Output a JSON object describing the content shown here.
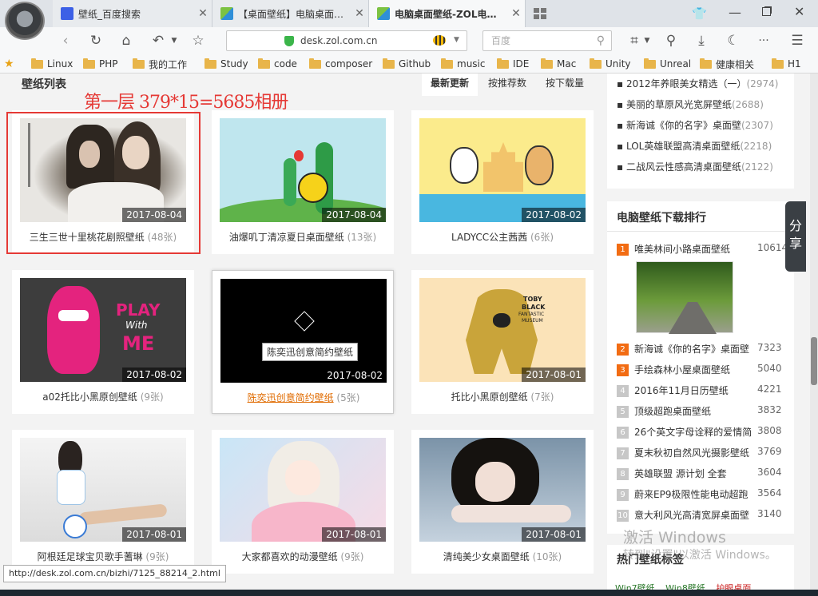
{
  "browser": {
    "tabs": [
      {
        "title": "壁纸_百度搜索",
        "icon": "baidu-paw-icon"
      },
      {
        "title": "【桌面壁纸】电脑桌面…",
        "icon": "zol-z-icon"
      },
      {
        "title": "电脑桌面壁纸-ZOL电…",
        "icon": "zol-z-icon"
      }
    ],
    "url": "desk.zol.com.cn",
    "search_placeholder": "百度",
    "status_url": "http://desk.zol.com.cn/bizhi/7125_88214_2.html"
  },
  "bookmarks": [
    "Linux",
    "PHP",
    "我的工作",
    "Study",
    "code",
    "composer",
    "Github",
    "music",
    "IDE",
    "Mac",
    "Unity",
    "Unreal",
    "健康相关",
    "H1"
  ],
  "section": {
    "title": "壁纸列表",
    "sort_tabs": [
      "最新更新",
      "按推荐数",
      "按下载量"
    ],
    "annotation": "第一层 379*15=5685相册"
  },
  "cards": [
    {
      "title": "三生三世十里桃花剧照壁纸",
      "count": "(48张)",
      "date": "2017-08-04"
    },
    {
      "title": "油爆叽丁清凉夏日桌面壁纸",
      "count": "(13张)",
      "date": "2017-08-04"
    },
    {
      "title": "LADYCC公主茜茜",
      "count": "(6张)",
      "date": "2017-08-02"
    },
    {
      "title": "a02托比小黑原创壁纸",
      "count": "(9张)",
      "date": "2017-08-02"
    },
    {
      "title": "陈奕迅创意简约壁纸",
      "count": "(5张)",
      "date": "2017-08-02",
      "tooltip": "陈奕迅创意简约壁纸"
    },
    {
      "title": "托比小黑原创壁纸",
      "count": "(7张)",
      "date": "2017-08-01"
    },
    {
      "title": "阿根廷足球宝贝歌手蓍琳",
      "count": "(9张)",
      "date": "2017-08-01"
    },
    {
      "title": "大家都喜欢的动漫壁纸",
      "count": "(9张)",
      "date": "2017-08-01"
    },
    {
      "title": "清纯美少女桌面壁纸",
      "count": "(10张)",
      "date": "2017-08-01"
    }
  ],
  "art": {
    "play_1": "PLAY",
    "play_2": "With",
    "play_3": "ME",
    "toby_1": "TOBY",
    "toby_2": "BLACK",
    "toby_3": "FANTASTIC",
    "toby_4": "MUSEUM"
  },
  "sidebar": {
    "top_list": [
      {
        "name": "2012年养眼美女精选（一）",
        "count": "(2974)"
      },
      {
        "name": "美丽的草原风光宽屏壁纸",
        "count": "(2688)"
      },
      {
        "name": "新海诚《你的名字》桌面壁",
        "count": "(2307)"
      },
      {
        "name": "LOL英雄联盟高清桌面壁纸",
        "count": "(2218)"
      },
      {
        "name": "二战风云性感高清桌面壁纸",
        "count": "(2122)"
      }
    ],
    "ranking_title": "电脑壁纸下载排行",
    "ranking": [
      {
        "num": "1",
        "name": "唯美林间小路桌面壁纸",
        "value": "10614"
      },
      {
        "num": "2",
        "name": "新海诚《你的名字》桌面壁",
        "value": "7323"
      },
      {
        "num": "3",
        "name": "手绘森林小屋桌面壁纸",
        "value": "5040"
      },
      {
        "num": "4",
        "name": "2016年11月日历壁纸",
        "value": "4221"
      },
      {
        "num": "5",
        "name": "顶级超跑桌面壁纸",
        "value": "3832"
      },
      {
        "num": "6",
        "name": "26个英文字母诠释的爱情简",
        "value": "3808"
      },
      {
        "num": "7",
        "name": "夏末秋初自然风光摄影壁纸",
        "value": "3769"
      },
      {
        "num": "8",
        "name": "英雄联盟 源计划 全套",
        "value": "3604"
      },
      {
        "num": "9",
        "name": "蔚来EP9极限性能电动超跑",
        "value": "3564"
      },
      {
        "num": "10",
        "name": "意大利风光高清宽屏桌面壁",
        "value": "3140"
      }
    ],
    "share_label_1": "分",
    "share_label_2": "享",
    "tags_title": "热门壁纸标签",
    "tags": [
      "Win7壁纸",
      "Win8壁纸",
      "护眼桌面"
    ]
  },
  "watermark": {
    "line1": "激活 Windows",
    "line2": "转到\"设置\"以激活 Windows。"
  },
  "colors": {
    "rank_top": "#f26c13",
    "rank_other": "#c7c7c7",
    "annotation": "#e53935",
    "link_orange": "#e06b00"
  }
}
